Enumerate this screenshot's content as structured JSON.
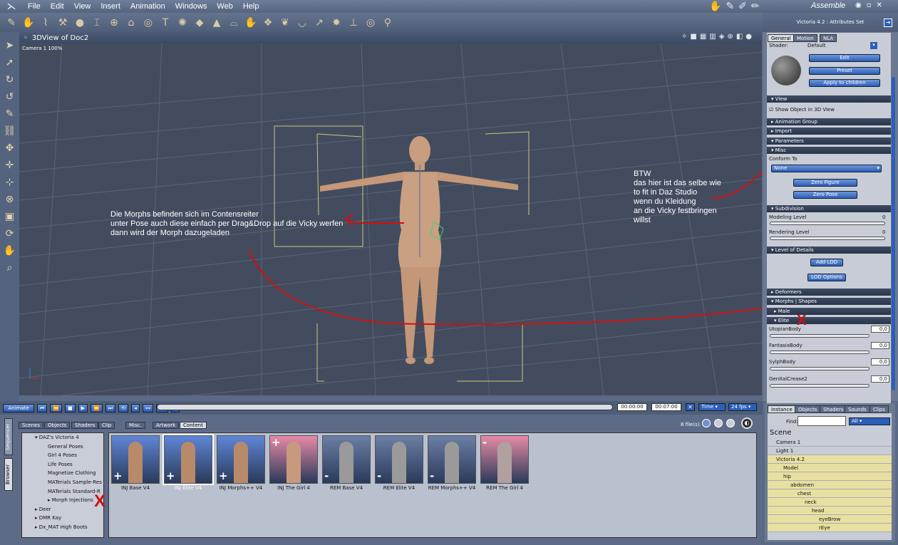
{
  "menu": [
    "File",
    "Edit",
    "View",
    "Insert",
    "Animation",
    "Windows",
    "Web",
    "Help"
  ],
  "mode_label": "Assemble",
  "viewport": {
    "title": "3DView of Doc2",
    "camera_label": "Camera 1 100%"
  },
  "annotations": {
    "left_text": [
      "Die Morphs befinden sich  im Contensreiter",
      "unter Pose auch diese einfach per Drag&Drop auf die Vicky werfen",
      "dann wird der Morph dazugeladen"
    ],
    "right_text": [
      "BTW",
      "das hier ist das selbe wie",
      "to fit in Daz Studio",
      "wenn du Kleidung",
      "an die Vicky festbringen",
      "willst"
    ],
    "x_mark": "X",
    "colors": {
      "annotation": "#d01010"
    }
  },
  "attributes": {
    "header": "Victoria 4.2 : Attributes Set",
    "tabs": [
      "General",
      "Motion",
      "NLA"
    ],
    "shader_label": "Shader:",
    "shader_value": "Default",
    "buttons": {
      "edit": "Edit",
      "preset": "Preset",
      "apply": "Apply to children",
      "zero_figure": "Zero Figure",
      "zero_pose": "Zero Pose",
      "add_lod": "Add LOD",
      "lod_options": "LOD Options"
    },
    "sections": {
      "view": "View",
      "anim_group": "Animation Group",
      "import": "Import",
      "parameters": "Parameters",
      "misc": "Misc",
      "subdivision": "Subdivision",
      "lod": "Level of Details",
      "deformers": "Deformers",
      "morphs": "Morphs | Shapes",
      "male": "Male",
      "elite": "Elite"
    },
    "show_object": "Show Object in 3D View",
    "conform_to_label": "Conform To",
    "conform_to_value": "None",
    "modeling_level": {
      "label": "Modeling Level",
      "value": "0"
    },
    "rendering_level": {
      "label": "Rendering Level",
      "value": "0"
    },
    "morphs": [
      {
        "name": "UtopianBody",
        "value": "0,0"
      },
      {
        "name": "FantasiaBody",
        "value": "0,0"
      },
      {
        "name": "SylphBody",
        "value": "0,0"
      },
      {
        "name": "GenitalCrease2",
        "value": "0,0"
      }
    ]
  },
  "animation": {
    "button": "Animate",
    "time_current": "00:00:00",
    "time_end": "00:07:00",
    "time_mode": "Time",
    "fps": "24 fps"
  },
  "browser": {
    "vertical_tabs": [
      "Sequencer",
      "Browser"
    ],
    "tabs": [
      "Scenes",
      "Objects",
      "Shaders",
      "Clip",
      "Misc.",
      "Artwork",
      "Content"
    ],
    "file_count": "8 file(s).",
    "tree": [
      {
        "label": "DAZ's Victoria 4",
        "indent": 1
      },
      {
        "label": "General Poses",
        "indent": 2
      },
      {
        "label": "Girl 4 Poses",
        "indent": 2
      },
      {
        "label": "Life Poses",
        "indent": 2
      },
      {
        "label": "Magnetize Clothing",
        "indent": 2
      },
      {
        "label": "MATerials Sample-Res",
        "indent": 2
      },
      {
        "label": "MATerials Standard-R",
        "indent": 2
      },
      {
        "label": "Morph Injections",
        "indent": 2
      },
      {
        "label": "Deer",
        "indent": 1
      },
      {
        "label": "DMR Kay",
        "indent": 1
      },
      {
        "label": "Dx_MAT High Boots",
        "indent": 1
      }
    ],
    "thumbnails": [
      {
        "label": "INJ Base V4",
        "sign": "+",
        "bg": "#5f86d6",
        "skin": "#b88a6a"
      },
      {
        "label": "INJ Elite V4",
        "sign": "+",
        "bg": "#5f86d6",
        "skin": "#b88a6a"
      },
      {
        "label": "INJ Morphs++ V4",
        "sign": "+",
        "bg": "#5f86d6",
        "skin": "#b88a6a"
      },
      {
        "label": "INJ The Girl 4",
        "sign": "+",
        "bg": "#e58aa6",
        "skin": "#c79a7e"
      },
      {
        "label": "REM Base V4",
        "sign": "-",
        "bg": "#6c7fa4",
        "skin": "#9a9a9a"
      },
      {
        "label": "REM Elite V4",
        "sign": "-",
        "bg": "#6c7fa4",
        "skin": "#9a9a9a"
      },
      {
        "label": "REM Morphs++ V4",
        "sign": "-",
        "bg": "#6c7fa4",
        "skin": "#9a9a9a"
      },
      {
        "label": "REM The Girl 4",
        "sign": "-",
        "bg": "#e58aa6",
        "skin": "#b0a0a0"
      }
    ]
  },
  "scene_panel": {
    "tabs": [
      "Instance",
      "Objects",
      "Shaders",
      "Sounds",
      "Clips"
    ],
    "find_label": "Find:",
    "filter": "All",
    "title": "Scene",
    "rows": [
      {
        "label": "Camera 1",
        "indent": 0,
        "hl": false
      },
      {
        "label": "Light 1",
        "indent": 0,
        "hl": false
      },
      {
        "label": "Victoria 4.2",
        "indent": 0,
        "hl": true
      },
      {
        "label": "Model",
        "indent": 1,
        "hl": true
      },
      {
        "label": "hip",
        "indent": 1,
        "hl": true
      },
      {
        "label": "abdomen",
        "indent": 2,
        "hl": true
      },
      {
        "label": "chest",
        "indent": 3,
        "hl": true
      },
      {
        "label": "neck",
        "indent": 4,
        "hl": true
      },
      {
        "label": "head",
        "indent": 5,
        "hl": true
      },
      {
        "label": "eyeBrow",
        "indent": 6,
        "hl": true
      },
      {
        "label": "rEye",
        "indent": 6,
        "hl": true
      }
    ]
  }
}
